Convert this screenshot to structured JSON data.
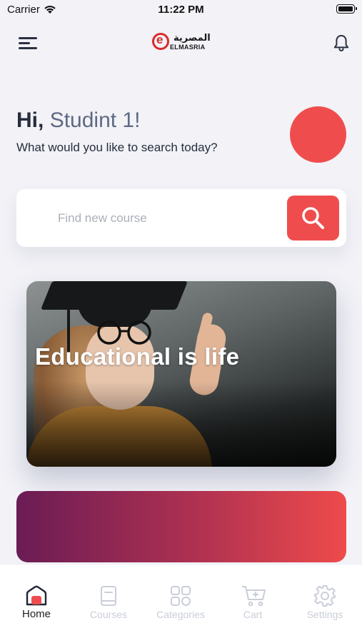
{
  "status_bar": {
    "carrier": "Carrier",
    "time": "11:22 PM"
  },
  "header": {
    "logo_arabic": "المصرية",
    "logo_english": "ELMASRIA"
  },
  "greeting": {
    "hi": "Hi,",
    "name": "Studint 1!",
    "subtitle": "What would you like to search today?"
  },
  "search": {
    "placeholder": "Find new course"
  },
  "banner": {
    "title": "Educational is life"
  },
  "tabs": [
    {
      "label": "Home",
      "icon": "home-icon",
      "active": true
    },
    {
      "label": "Courses",
      "icon": "book-icon",
      "active": false
    },
    {
      "label": "Categories",
      "icon": "grid-icon",
      "active": false
    },
    {
      "label": "Cart",
      "icon": "cart-icon",
      "active": false
    },
    {
      "label": "Settings",
      "icon": "gear-icon",
      "active": false
    }
  ],
  "colors": {
    "accent": "#ef4d4d",
    "background": "#f2f2f7",
    "text": "#252d3d",
    "muted": "#5e6a83",
    "tab_inactive": "#c9ced8"
  }
}
